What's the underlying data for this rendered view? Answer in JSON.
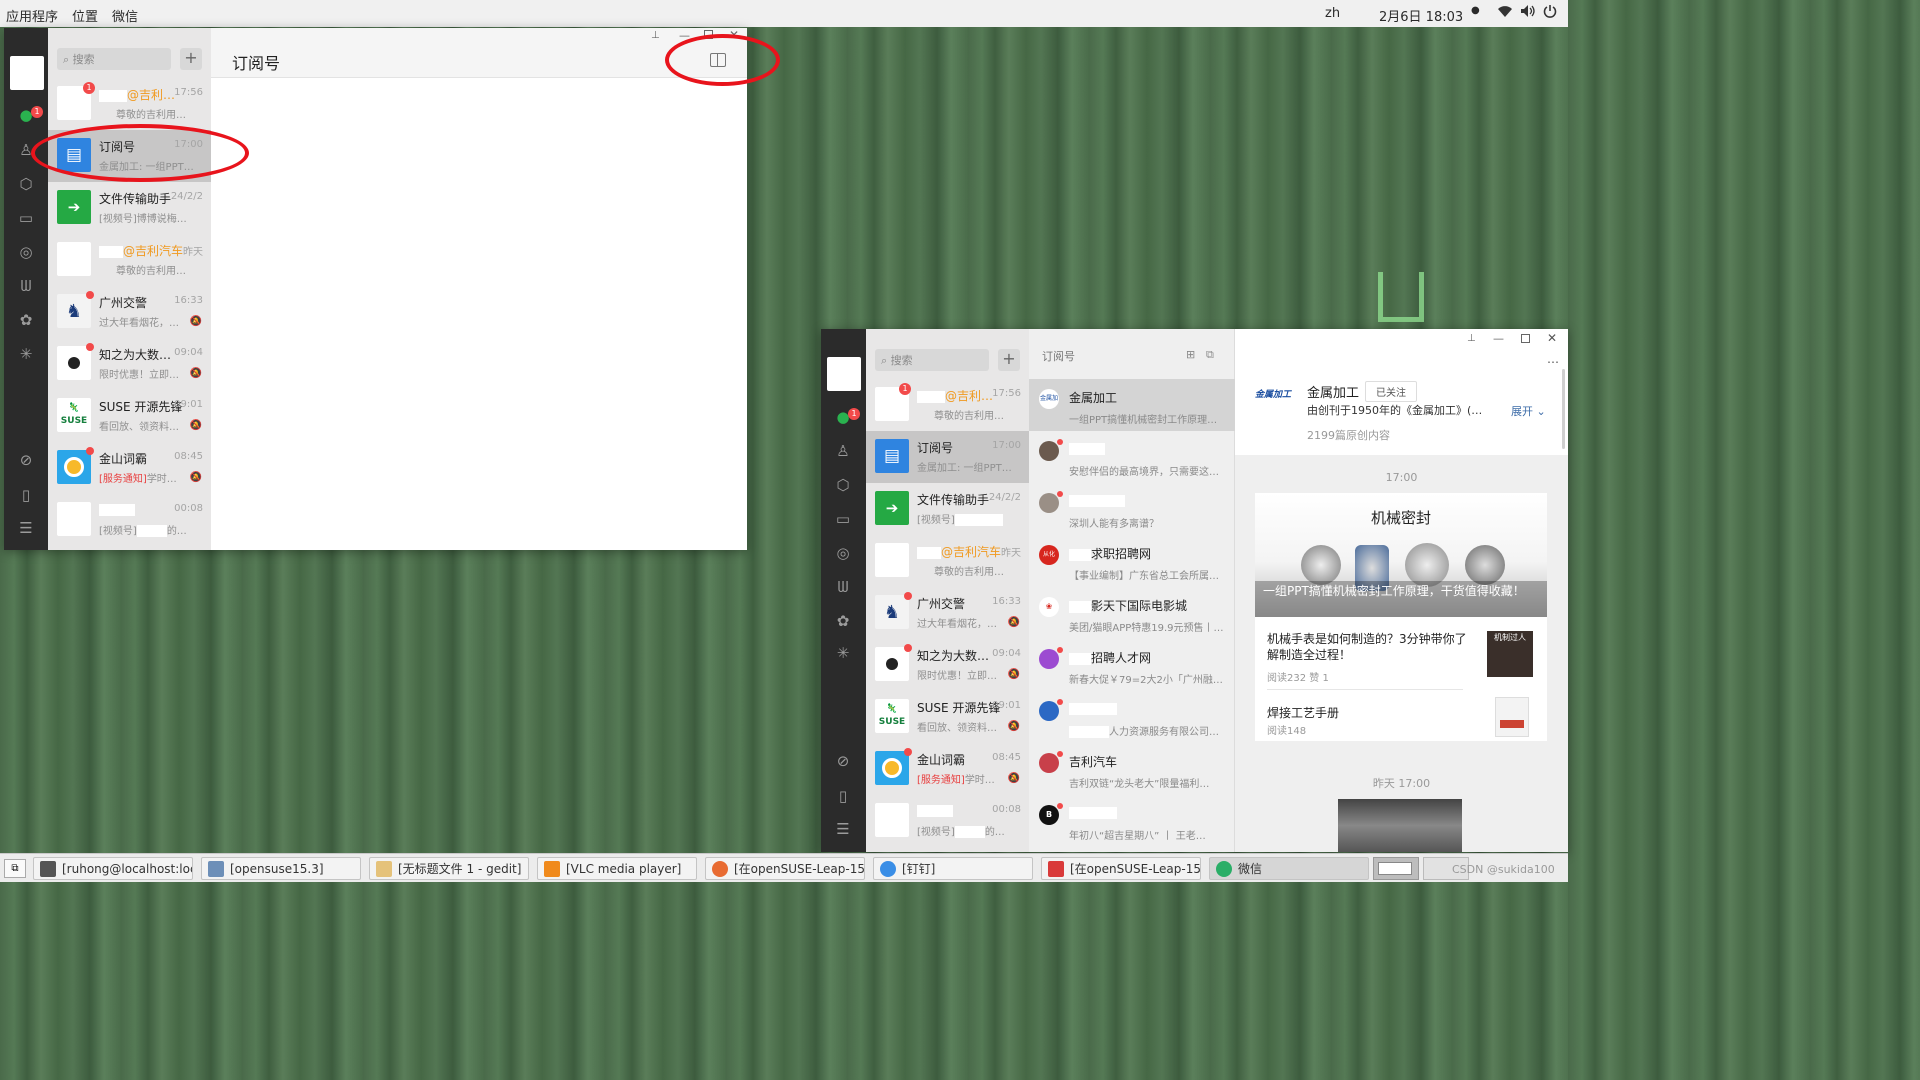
{
  "top_panel": {
    "menu": [
      "应用程序",
      "位置",
      "微信"
    ],
    "lang": "zh",
    "datetime": "2月6日 18:03"
  },
  "wechat_small": {
    "search_placeholder": "搜索",
    "plus": "+",
    "title": "订阅号",
    "unread_badge": "1",
    "chats": [
      {
        "name": "@吉利…",
        "time": "17:56",
        "msg": "尊敬的吉利用…",
        "badge": "1"
      },
      {
        "name": "订阅号",
        "time": "17:00",
        "msg": "金属加工: 一组PPT…"
      },
      {
        "name": "文件传输助手",
        "time": "24/2/2",
        "msg": "[视频号]博博说梅…"
      },
      {
        "name": "@吉利汽车",
        "time": "昨天",
        "msg": "尊敬的吉利用…"
      },
      {
        "name": "广州交警",
        "time": "16:33",
        "msg": "过大年看烟花，…"
      },
      {
        "name": "知之为大数…",
        "time": "09:04",
        "msg": "限时优惠！立即…"
      },
      {
        "name": "SUSE 开源先锋",
        "time": "09:01",
        "msg": "看回放、领资料…",
        "suse_text": "SUSE"
      },
      {
        "name": "金山词霸",
        "time": "08:45",
        "msg_tag": "[服务通知]",
        "msg": "学时…"
      },
      {
        "name": "",
        "time": "00:08",
        "msg": "[视频号]",
        "msg_tail": "的…"
      }
    ]
  },
  "wechat_large": {
    "search_placeholder": "搜索",
    "plus": "+",
    "unread_badge": "1",
    "chats": [
      {
        "name": "@吉利…",
        "time": "17:56",
        "msg": "尊敬的吉利用…",
        "badge": "1"
      },
      {
        "name": "订阅号",
        "time": "17:00",
        "msg": "金属加工: 一组PPT…"
      },
      {
        "name": "文件传输助手",
        "time": "24/2/2",
        "msg": "[视频号]"
      },
      {
        "name": "@吉利汽车",
        "time": "昨天",
        "msg": "尊敬的吉利用…"
      },
      {
        "name": "广州交警",
        "time": "16:33",
        "msg": "过大年看烟花，…"
      },
      {
        "name": "知之为大数…",
        "time": "09:04",
        "msg": "限时优惠！立即…"
      },
      {
        "name": "SUSE 开源先锋",
        "time": "09:01",
        "msg": "看回放、领资料…",
        "suse_text": "SUSE"
      },
      {
        "name": "金山词霸",
        "time": "08:45",
        "msg_tag": "[服务通知]",
        "msg": "学时…"
      },
      {
        "name": "",
        "time": "00:08",
        "msg": "[视频号]",
        "msg_tail": "的…"
      }
    ],
    "feed_title": "订阅号",
    "feed": [
      {
        "name": "金属加工",
        "msg": "一组PPT搞懂机械密封工作原理…",
        "avatar_text": "金属加工"
      },
      {
        "name": "",
        "msg": "安慰伴侣的最高境界，只需要这…"
      },
      {
        "name": "",
        "msg": "深圳人能有多离谱？"
      },
      {
        "name": "求职招聘网",
        "msg": "【事业编制】广东省总工会所属…",
        "avatar_text": "从化"
      },
      {
        "name": "影天下国际电影城",
        "msg": "美团/猫眼APP特惠19.9元预售丨…"
      },
      {
        "name": "招聘人才网",
        "msg": "新春大促￥79=2大2小「广州融…"
      },
      {
        "name": "",
        "msg": "人力资源服务有限公司…"
      },
      {
        "name": "吉利汽车",
        "msg": "吉利双链“龙头老大”限量福利…"
      },
      {
        "name": "",
        "msg": "年初八“超吉星期八” 丨 王老…",
        "avatar_text": "B"
      }
    ],
    "account": {
      "name": "金属加工",
      "follow": "已关注",
      "desc": "由创刊于1950年的《金属加工》(…",
      "expand": "展开",
      "count": "2199篇原创内容",
      "logo_text": "金属加工"
    },
    "time1": "17:00",
    "card_title": "机械密封",
    "card_caption": "一组PPT搞懂机械密封工作原理，干货值得收藏！",
    "article1": {
      "title": "机械手表是如何制造的？3分钟带你了解制造全过程！",
      "stats": "阅读232 赞 1",
      "thumb": "机制过人"
    },
    "article2": {
      "title": "焊接工艺手册",
      "stats": "阅读148"
    },
    "time2": "昨天 17:00"
  },
  "taskbar": [
    {
      "label": "[ruhong@localhost:loca…",
      "color": "#555555"
    },
    {
      "label": "[opensuse15.3]",
      "color": "#6d8fb8"
    },
    {
      "label": "[无标题文件 1 - gedit]",
      "color": "#e5c27a"
    },
    {
      "label": "[VLC media player]",
      "color": "#f08a1c"
    },
    {
      "label": "[在openSUSE-Leap-15.…",
      "color": "#e86b32"
    },
    {
      "label": "[钉钉]",
      "color": "#3a8ee6"
    },
    {
      "label": "[在openSUSE-Leap-15.…",
      "color": "#d93a3a"
    },
    {
      "label": "微信",
      "color": "#2aae67"
    }
  ],
  "watermark": "CSDN @sukida100"
}
